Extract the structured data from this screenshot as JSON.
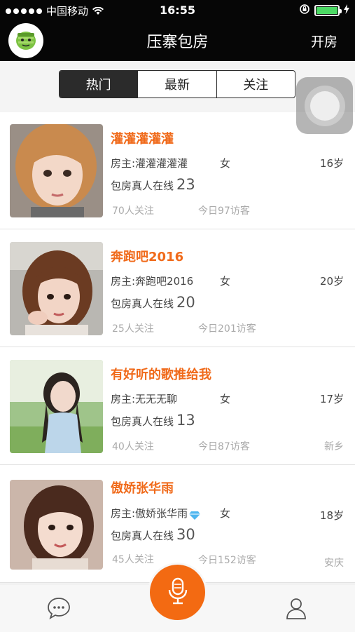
{
  "status_bar": {
    "carrier": "中国移动",
    "time": "16:55"
  },
  "header": {
    "title": "压寨包房",
    "right_action": "开房",
    "logo_icon": "green-mascot-icon"
  },
  "segments": {
    "tabs": [
      "热门",
      "最新",
      "关注"
    ],
    "active": "热门"
  },
  "labels": {
    "online_prefix": "包房真人在线"
  },
  "rooms": [
    {
      "name": "灌灌灌灌灌",
      "host": "房主:灌灌灌灌灌",
      "gender": "女",
      "age": "16岁",
      "online": "23",
      "follows": "70人关注",
      "visitors": "今日97访客",
      "city": ""
    },
    {
      "name": "奔跑吧2016",
      "host": "房主:奔跑吧2016",
      "gender": "女",
      "age": "20岁",
      "online": "20",
      "follows": "25人关注",
      "visitors": "今日201访客",
      "city": ""
    },
    {
      "name": "有好听的歌推给我",
      "host": "房主:无无无聊",
      "gender": "女",
      "age": "17岁",
      "online": "13",
      "follows": "40人关注",
      "visitors": "今日87访客",
      "city": "新乡"
    },
    {
      "name": "傲娇张华雨",
      "host": "房主:傲娇张华雨",
      "gender": "女",
      "age": "18岁",
      "online": "30",
      "follows": "45人关注",
      "visitors": "今日152访客",
      "city": "安庆"
    }
  ],
  "tabbar": {
    "items": [
      "chat-bubble-icon",
      "microphone-icon",
      "user-profile-icon"
    ],
    "accent": "#f36a12"
  },
  "colors": {
    "header_bg": "#060606",
    "room_name": "#f06a1a",
    "battery": "#4cd964"
  }
}
